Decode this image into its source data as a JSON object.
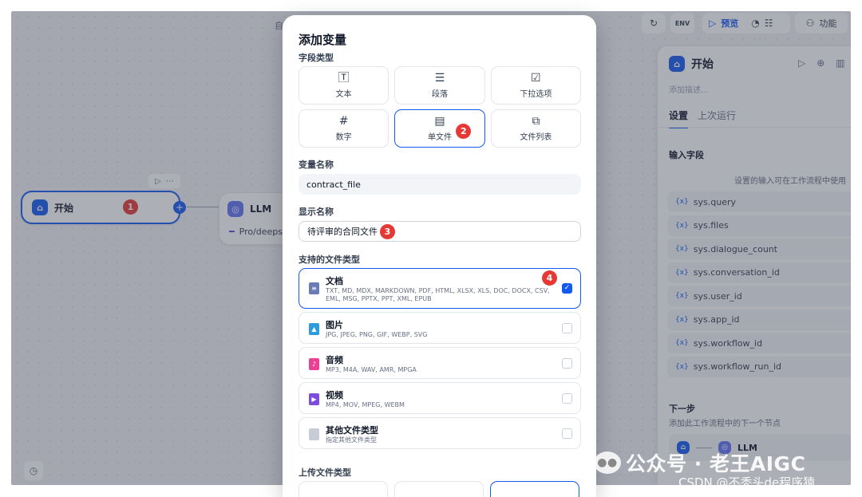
{
  "toolbar": {
    "breadcrumb_fragment": "自",
    "env_label": "ENV",
    "preview_label": "预览",
    "features_label": "功能"
  },
  "canvas": {
    "start_node": {
      "title": "开始",
      "badge": "1"
    },
    "llm_node": {
      "title": "LLM",
      "model": "Pro/deeps"
    }
  },
  "modal": {
    "title": "添加变量",
    "field_type_label": "字段类型",
    "field_types": [
      {
        "label": "文本",
        "icon": "text-icon"
      },
      {
        "label": "段落",
        "icon": "paragraph-icon"
      },
      {
        "label": "下拉选项",
        "icon": "select-icon"
      },
      {
        "label": "数字",
        "icon": "hash-icon"
      },
      {
        "label": "单文件",
        "icon": "file-icon",
        "selected": true,
        "badge": "2"
      },
      {
        "label": "文件列表",
        "icon": "file-list-icon"
      }
    ],
    "var_name_label": "变量名称",
    "var_name_value": "contract_file",
    "display_name_label": "显示名称",
    "display_name_value": "待评审的合同文件",
    "display_name_badge": "3",
    "supported_types_label": "支持的文件类型",
    "supported_types_badge": "4",
    "file_types": [
      {
        "name": "文档",
        "ext": "TXT, MD, MDX, MARKDOWN, PDF, HTML, XLSX, XLS, DOC, DOCX, CSV, EML, MSG, PPTX, PPT, XML, EPUB",
        "color": "#6a7bb4",
        "checked": true
      },
      {
        "name": "图片",
        "ext": "JPG, JPEG, PNG, GIF, WEBP, SVG",
        "color": "#2d9cdb",
        "checked": false
      },
      {
        "name": "音频",
        "ext": "MP3, M4A, WAV, AMR, MPGA",
        "color": "#e84393",
        "checked": false
      },
      {
        "name": "视频",
        "ext": "MP4, MOV, MPEG, WEBM",
        "color": "#7c4ddb",
        "checked": false
      },
      {
        "name": "其他文件类型",
        "ext": "指定其他文件类型",
        "color": "#c8ccd4",
        "checked": false
      }
    ],
    "upload_type_label": "上传文件类型"
  },
  "panel": {
    "title": "开始",
    "description_placeholder": "添加描述...",
    "tabs": [
      "设置",
      "上次运行"
    ],
    "input_fields_label": "输入字段",
    "input_hint": "设置的输入可在工作流程中使用",
    "sys_vars": [
      "sys.query",
      "sys.files",
      "sys.dialogue_count",
      "sys.conversation_id",
      "sys.user_id",
      "sys.app_id",
      "sys.workflow_id",
      "sys.workflow_run_id"
    ],
    "next_step_label": "下一步",
    "next_step_hint": "添加此工作流程中的下一个节点",
    "next_node": "LLM"
  },
  "watermark": {
    "line1": "公众号 · 老王AIGC",
    "line2": "CSDN @不秃头de程序猿"
  },
  "colors": {
    "accent": "#155aef",
    "badge": "#e53935"
  }
}
